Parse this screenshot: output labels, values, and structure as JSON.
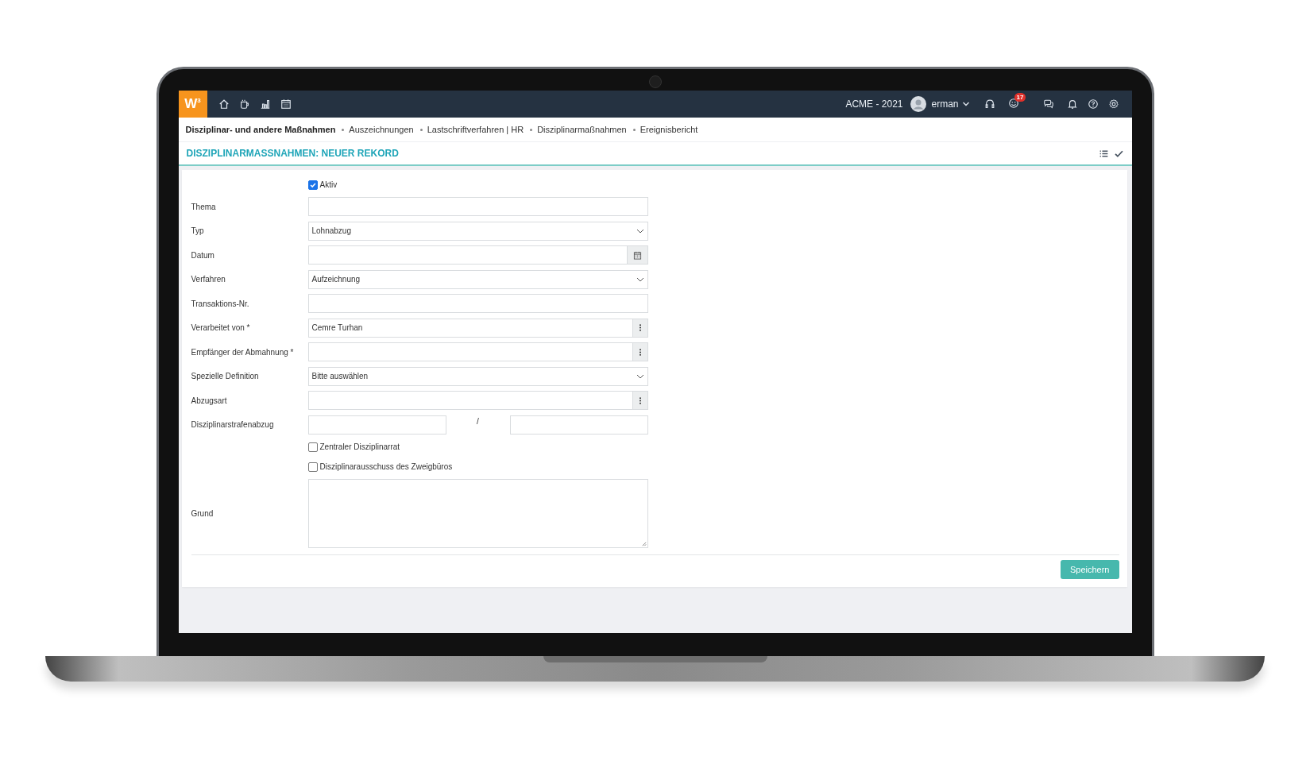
{
  "topbar": {
    "logo": "W$^{3}$",
    "company": "ACME - 2021",
    "user": "erman",
    "notification_count": "17"
  },
  "breadcrumbs": [
    {
      "label": "Disziplinar- und andere Maßnahmen",
      "selected": true
    },
    {
      "label": "Auszeichnungen",
      "selected": false
    },
    {
      "label": "Lastschriftverfahren | HR",
      "selected": false
    },
    {
      "label": "Disziplinarmaßnahmen",
      "selected": false
    },
    {
      "label": "Ereignisbericht",
      "selected": false
    }
  ],
  "title": "DISZIPLINARMASSNAHMEN: NEUER REKORD",
  "form": {
    "fields": [
      {
        "kind": "checkbox",
        "label": "Aktiv",
        "checked": true
      },
      {
        "kind": "text",
        "label": "Thema"
      },
      {
        "kind": "select",
        "label": "Typ",
        "value": "Lohnabzug"
      },
      {
        "kind": "date",
        "label": "Datum"
      },
      {
        "kind": "select",
        "label": "Verfahren",
        "value": "Aufzeichnung"
      },
      {
        "kind": "text",
        "label": "Transaktions-Nr."
      },
      {
        "kind": "picker",
        "label": "Verarbeitet von *",
        "value": "Cemre Turhan"
      },
      {
        "kind": "picker",
        "label": "Empfänger der Abmahnung *"
      },
      {
        "kind": "select",
        "label": "Spezielle Definition",
        "value": "Bitte auswählen"
      },
      {
        "kind": "picker",
        "label": "Abzugsart"
      },
      {
        "kind": "range",
        "label": "Disziplinarstrafenabzug",
        "separator": "/"
      },
      {
        "kind": "checkbox",
        "label": "Zentraler Disziplinarrat",
        "checked": false
      },
      {
        "kind": "checkbox",
        "label": "Disziplinarausschuss des Zweigbüros",
        "checked": false
      },
      {
        "kind": "textarea",
        "label": "Grund"
      }
    ],
    "save_button": "Speichern"
  }
}
